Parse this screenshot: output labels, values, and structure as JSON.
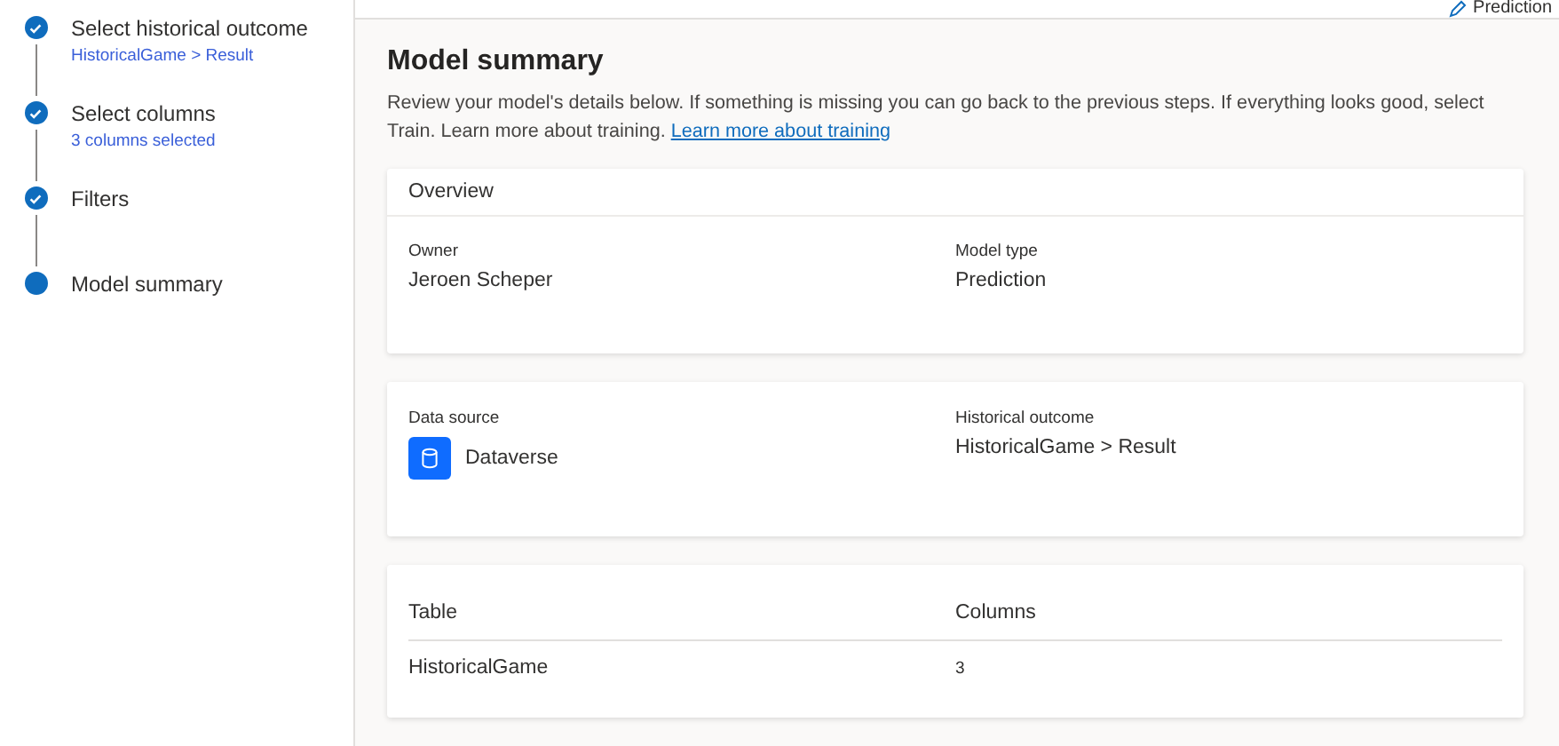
{
  "steps": [
    {
      "title": "Select historical outcome",
      "subtitle": "HistoricalGame > Result",
      "completed": true
    },
    {
      "title": "Select columns",
      "subtitle": "3 columns selected",
      "completed": true
    },
    {
      "title": "Filters",
      "completed": true
    },
    {
      "title": "Model summary",
      "completed": false
    }
  ],
  "top_bar": {
    "model_type_label": "Prediction"
  },
  "summary": {
    "title": "Model summary",
    "description": "Review your model's details below. If something is missing you can go back to the previous steps. If everything looks good, select Train. Learn more about training.",
    "link": "Learn more about training"
  },
  "overview": {
    "title": "Overview",
    "owner_label": "Owner",
    "owner": "Jeroen Scheper",
    "model_type_label": "Model type",
    "model_type": "Prediction"
  },
  "source": {
    "data_source_label": "Data source",
    "data_source": "Dataverse",
    "outcome_label": "Historical outcome",
    "outcome": "HistoricalGame > Result"
  },
  "table": {
    "columns": [
      "Table",
      "Columns"
    ],
    "rows": [
      [
        "HistoricalGame",
        "3"
      ]
    ]
  }
}
